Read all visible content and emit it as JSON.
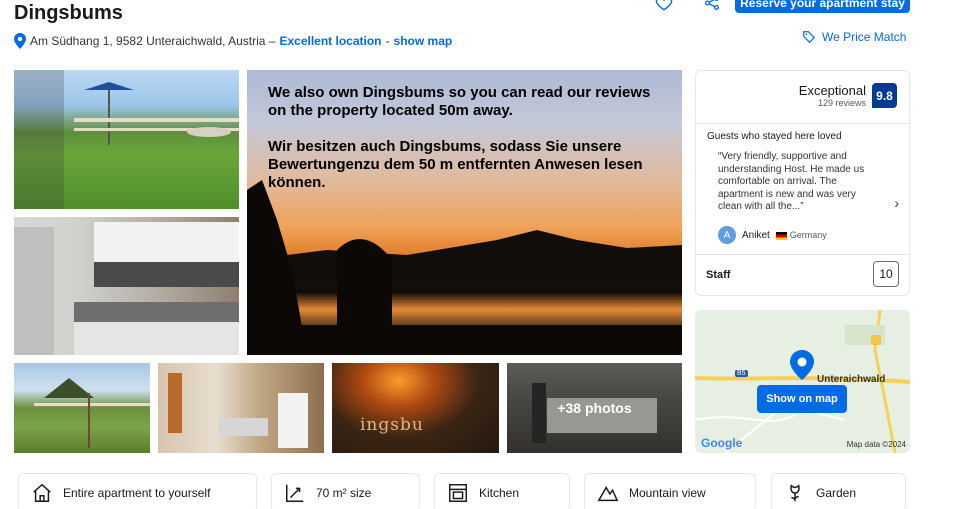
{
  "header": {
    "title": "Dingsbums",
    "address": "Am Südhang 1, 9582 Unteraichwald, Austria –",
    "location_rating": "Excellent location",
    "location_sep": "-",
    "show_map": "show map",
    "reserve_button": "Reserve your apartment stay",
    "price_match": "We Price Match"
  },
  "gallery": {
    "main_caption_en": "We also own Dingsbums so you can read our reviews on the property located 50m away.",
    "main_caption_de": "Wir besitzen auch Dingsbums, sodass Sie unsere Bewertungenzu dem 50 m entfernten Anwesen lesen können.",
    "burned_sign_text": "ingsbu",
    "more_photos": "+38 photos"
  },
  "review_card": {
    "rating_word": "Exceptional",
    "review_count": "129 reviews",
    "score": "9.8",
    "loved_heading": "Guests who stayed here loved",
    "quote": "“Very friendly, supportive and understanding Host. He made us comfortable on arrival. The apartment is new and was very clean with all the...”",
    "reviewer_initial": "A",
    "reviewer_name": "Aniket",
    "reviewer_country": "Germany",
    "staff_label": "Staff",
    "staff_score": "10"
  },
  "map": {
    "town": "Unteraichwald",
    "route": "B5",
    "button": "Show on map",
    "provider": "Google",
    "attribution": "Map data ©2024"
  },
  "facilities": [
    {
      "label": "Entire apartment to yourself",
      "icon": "house-icon"
    },
    {
      "label": "70 m² size",
      "icon": "size-icon"
    },
    {
      "label": "Kitchen",
      "icon": "kitchen-icon"
    },
    {
      "label": "Mountain view",
      "icon": "mountain-icon"
    },
    {
      "label": "Garden",
      "icon": "garden-icon"
    }
  ],
  "colors": {
    "accent": "#006ce4",
    "score_bg": "#003b95"
  }
}
